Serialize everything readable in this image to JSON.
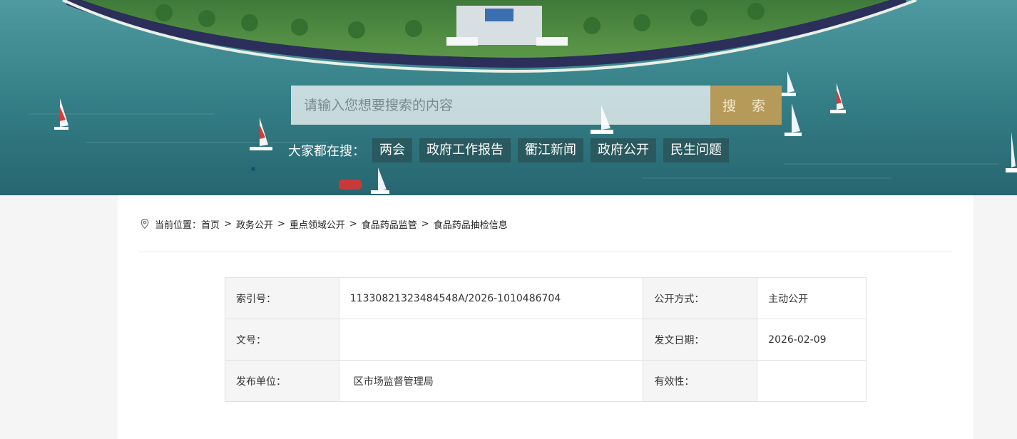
{
  "search": {
    "placeholder": "请输入您想要搜索的内容",
    "button_label": "搜 索"
  },
  "hot_search": {
    "label": "大家都在搜：",
    "tags": [
      "两会",
      "政府工作报告",
      "衢江新闻",
      "政府公开",
      "民生问题"
    ]
  },
  "breadcrumb": {
    "prefix": "当前位置：",
    "items": [
      "首页",
      "政务公开",
      "重点领域公开",
      "食品药品监管",
      "食品药品抽检信息"
    ],
    "separator": ">"
  },
  "meta_table": {
    "index_label": "索引号：",
    "index_value": "11330821323484548A/2026-1010486704",
    "disclosure_label": "公开方式：",
    "disclosure_value": "主动公开",
    "doc_no_label": "文号：",
    "doc_no_value": "",
    "date_label": "发文日期：",
    "date_value": "2026-02-09",
    "publisher_label": "发布单位：",
    "publisher_value": "区市场监督管理局",
    "validity_label": "有效性：",
    "validity_value": ""
  },
  "colors": {
    "search_button": "#b69a5a",
    "hot_tag_bg": "#285055",
    "water": "#2f7f86"
  }
}
